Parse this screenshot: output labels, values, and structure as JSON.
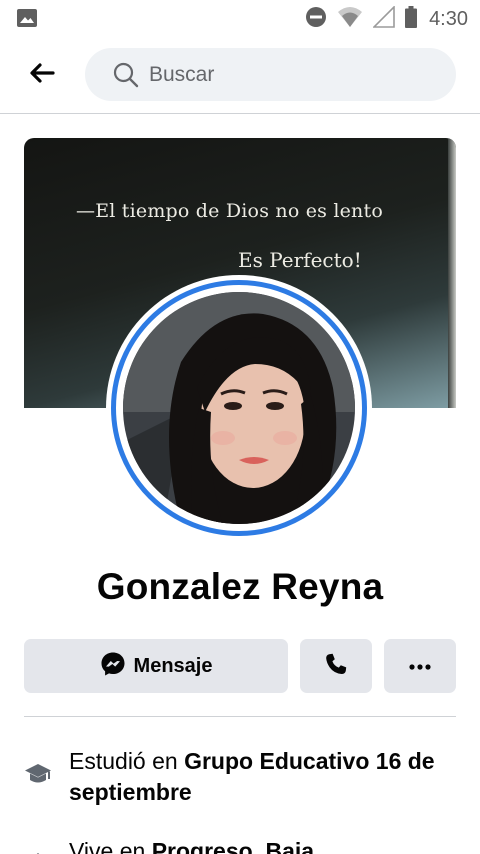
{
  "status_bar": {
    "time": "4:30",
    "icons": [
      "gallery-icon",
      "do-not-disturb-icon",
      "wifi-icon",
      "signal-icon",
      "battery-icon"
    ]
  },
  "nav": {
    "back_icon": "arrow-left-icon",
    "search_placeholder": "Buscar"
  },
  "cover": {
    "line1": "—El tiempo de Dios no es lento",
    "line2": "Es Perfecto!"
  },
  "profile": {
    "name": "Gonzalez Reyna",
    "ring_color": "#2d7be4"
  },
  "actions": {
    "message_label": "Mensaje",
    "message_icon": "messenger-icon",
    "call_icon": "phone-icon",
    "more_label": "···"
  },
  "info": {
    "studied_prefix": "Estudió en ",
    "studied_value": "Grupo Educativo 16 de septiembre",
    "studied_icon": "graduation-cap-icon",
    "lives_prefix": "Vive en ",
    "lives_value": "Progreso, Baja",
    "lives_icon": "home-icon"
  },
  "colors": {
    "accent": "#2d7be4",
    "button_bg": "#e4e6eb",
    "search_bg": "#eff2f5"
  }
}
